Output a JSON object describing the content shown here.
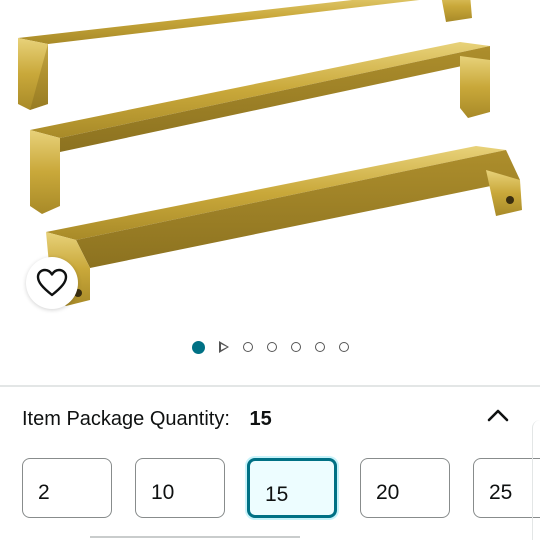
{
  "colors": {
    "accent": "#007185",
    "selected_bg": "#edfdff",
    "gold": "#c9a83a"
  },
  "product": {
    "image_icon": "gold-cabinet-handles-image"
  },
  "wishlist": {
    "icon": "heart-outline-icon"
  },
  "carousel": {
    "total_items": 7,
    "active_index": 0,
    "video_index": 1
  },
  "quantity": {
    "label": "Item Package Quantity:",
    "selected_value": "15",
    "collapse_icon": "chevron-up-icon",
    "options": [
      "2",
      "10",
      "15",
      "20",
      "25"
    ],
    "selected_index": 2
  }
}
